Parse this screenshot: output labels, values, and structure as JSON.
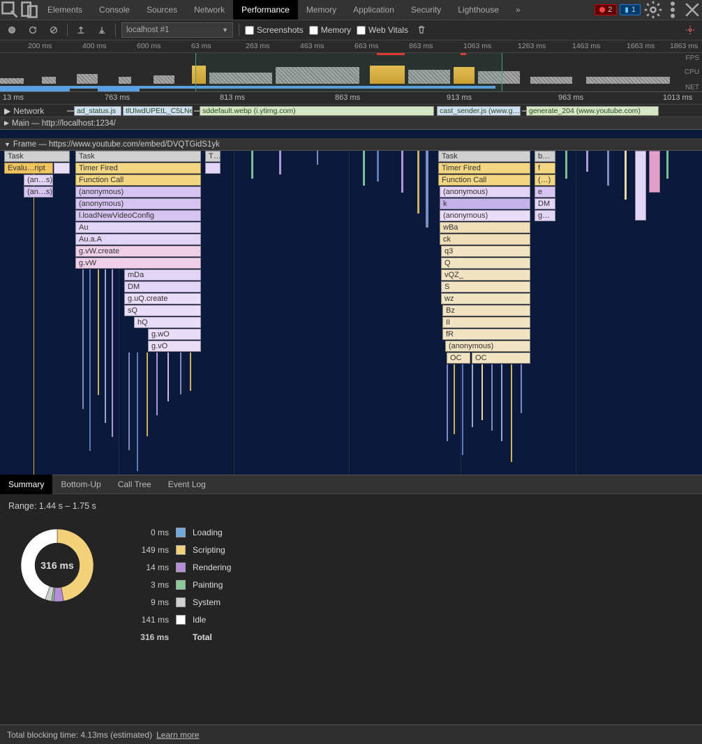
{
  "tabs": {
    "elements": "Elements",
    "console": "Console",
    "sources": "Sources",
    "network": "Network",
    "performance": "Performance",
    "memory": "Memory",
    "application": "Application",
    "security": "Security",
    "lighthouse": "Lighthouse",
    "more": "»"
  },
  "badges": {
    "errors": "2",
    "messages": "1"
  },
  "toolbar": {
    "target": "localhost #1",
    "screenshots": "Screenshots",
    "memory": "Memory",
    "webvitals": "Web Vitals"
  },
  "overview_ticks": [
    "200 ms",
    "400 ms",
    "600 ms",
    "63 ms",
    "263 ms",
    "463 ms",
    "663 ms",
    "863 ms",
    "1063 ms",
    "1263 ms",
    "1463 ms",
    "1663 ms",
    "1863 ms"
  ],
  "overview_lanes": {
    "fps": "FPS",
    "cpu": "CPU",
    "net": "NET"
  },
  "ruler_ticks": [
    "13 ms",
    "763 ms",
    "813 ms",
    "863 ms",
    "913 ms",
    "963 ms",
    "1013 ms"
  ],
  "network_row": {
    "label": "Network",
    "items": [
      "ad_status.js",
      "tlUlwdUPEtL_C5LNe",
      "sddefault.webp (i.ytimg.com)",
      "cast_sender.js (www.g…",
      "generate_204 (www.youtube.com)"
    ]
  },
  "threads": {
    "main": {
      "label": "Main — http://localhost:1234/"
    },
    "frame": {
      "label": "Frame — https://www.youtube.com/embed/DVQTGidS1yk"
    }
  },
  "flame_left": {
    "task": "Task",
    "evalscript": "Evalu…ript",
    "anon_s": "(an…s)",
    "timer": "Timer Fired",
    "fcall": "Function Call",
    "anon": "(anonymous)",
    "load": "l.loadNewVideoConfig",
    "au": "Au",
    "aua": "Au.a.A",
    "gvwcreate": "g.vW.create",
    "gvw": "g.vW",
    "mda": "mDa",
    "dm": "DM",
    "guq": "g.uQ.create",
    "sq": "sQ",
    "hq": "hQ",
    "gwo": "g.wO",
    "gvo": "g.vO"
  },
  "flame_mid": {
    "task": "T…"
  },
  "flame_right": {
    "task": "Task",
    "timer": "Timer Fired",
    "fcall": "Function Call",
    "anon": "(anonymous)",
    "k": "k",
    "wba": "wBa",
    "ck": "ck",
    "q3": "q3",
    "q": "Q",
    "vqz": "vQZ_",
    "s": "S",
    "wz": "wz",
    "bz": "Bz",
    "II": "II",
    "fr": "fR",
    "oc": "OC",
    "b": "b…",
    "f": "f",
    "dots": "(…)",
    "e": "e",
    "DM": "DM",
    "g": "g…"
  },
  "bottom_tabs": {
    "summary": "Summary",
    "bottomup": "Bottom-Up",
    "calltree": "Call Tree",
    "eventlog": "Event Log"
  },
  "summary": {
    "range": "Range: 1.44 s – 1.75 s",
    "center": "316 ms",
    "rows": [
      {
        "v": "0 ms",
        "n": "Loading",
        "c": "#6fa8dc"
      },
      {
        "v": "149 ms",
        "n": "Scripting",
        "c": "#f3d17a"
      },
      {
        "v": "14 ms",
        "n": "Rendering",
        "c": "#b48ed9"
      },
      {
        "v": "3 ms",
        "n": "Painting",
        "c": "#8bc99a"
      },
      {
        "v": "9 ms",
        "n": "System",
        "c": "#cfcfcf"
      },
      {
        "v": "141 ms",
        "n": "Idle",
        "c": "#ffffff"
      },
      {
        "v": "316 ms",
        "n": "Total",
        "c": ""
      }
    ]
  },
  "chart_data": {
    "type": "pie",
    "title": "Time breakdown",
    "categories": [
      "Loading",
      "Scripting",
      "Rendering",
      "Painting",
      "System",
      "Idle"
    ],
    "values": [
      0,
      149,
      14,
      3,
      9,
      141
    ],
    "total": 316,
    "unit": "ms",
    "colors": [
      "#6fa8dc",
      "#f3d17a",
      "#b48ed9",
      "#8bc99a",
      "#cfcfcf",
      "#ffffff"
    ]
  },
  "footer": {
    "tbt": "Total blocking time: 4.13ms (estimated)",
    "learn": "Learn more"
  }
}
